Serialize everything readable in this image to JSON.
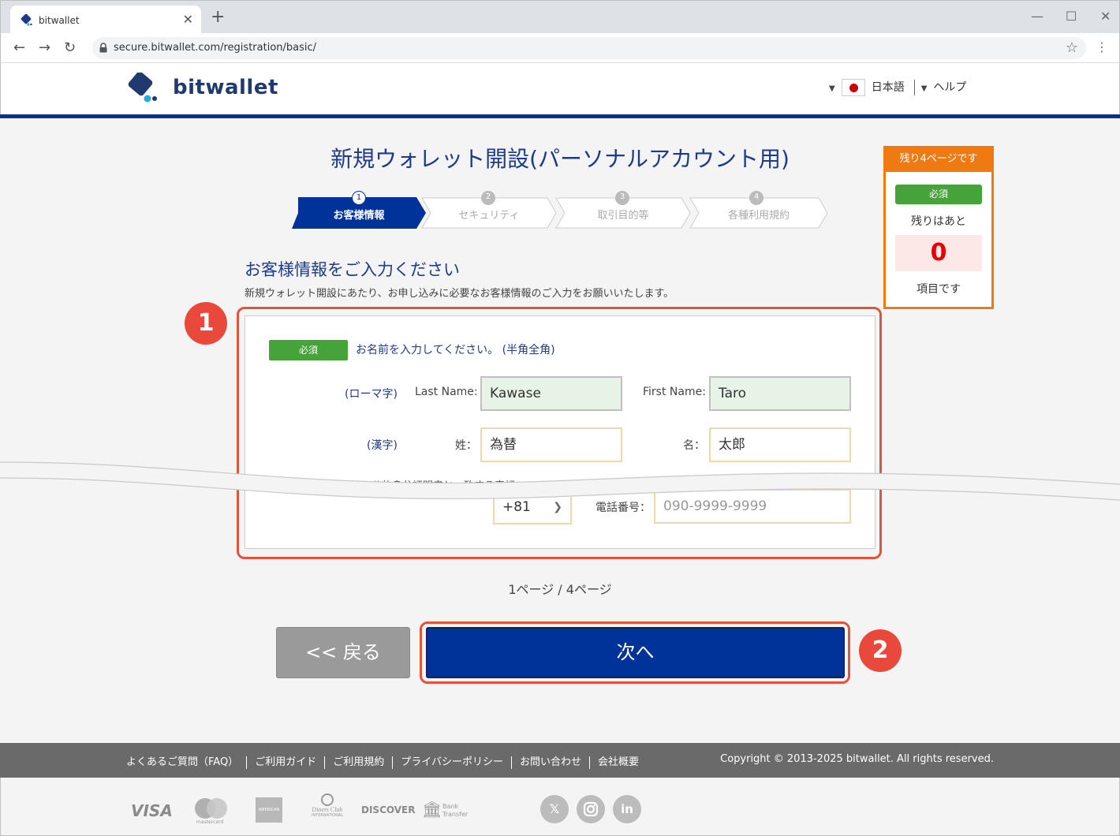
{
  "browser": {
    "tab_title": "bitwallet",
    "url": "secure.bitwallet.com/registration/basic/"
  },
  "header": {
    "brand": "bitwallet",
    "language": "日本語",
    "help": "ヘルプ"
  },
  "main": {
    "page_title": "新規ウォレット開設(パーソナルアカウント用)",
    "steps": [
      {
        "num": "1",
        "label": "お客様情報",
        "active": true
      },
      {
        "num": "2",
        "label": "セキュリティ",
        "active": false
      },
      {
        "num": "3",
        "label": "取引目的等",
        "active": false
      },
      {
        "num": "4",
        "label": "各種利用規約",
        "active": false
      }
    ],
    "section_title": "お客様情報をご入力ください",
    "section_desc": "新規ウォレット開設にあたり、お申し込みに必要なお客様情報のご入力をお願いいたします。",
    "callout_1": "1",
    "callout_2": "2",
    "form": {
      "required_badge": "必須",
      "name_hint": "お名前を入力してください。 (半角全角)",
      "romaji_label": "(ローマ字)",
      "last_name_label": "Last Name:",
      "last_name_value": "Kawase",
      "first_name_label": "First Name:",
      "first_name_value": "Taro",
      "kanji_label": "(漢字)",
      "sei_label": "姓：",
      "sei_value": "為替",
      "mei_label": "名：",
      "mei_value": "太郎",
      "note_partial": "ローマ字、漢字ともに公的身分証明書と一致する表記",
      "country_code": "+81",
      "phone_label": "電話番号：",
      "phone_placeholder": "090-9999-9999"
    },
    "pager": "1ページ / 4ページ",
    "back_button": "<< 戻る",
    "next_button": "次へ"
  },
  "sidebar": {
    "remaining_pages": "残り4ページです",
    "required_badge": "必須",
    "remaining_label": "残りはあと",
    "remaining_count": "0",
    "items_label": "項目です"
  },
  "footer": {
    "links": [
      "よくあるご質問（FAQ）",
      "ご利用ガイド",
      "ご利用規約",
      "プライバシーポリシー",
      "お問い合わせ",
      "会社概要"
    ],
    "copyright": "Copyright © 2013-2025 bitwallet. All rights reserved.",
    "payment_logos": {
      "visa": "VISA",
      "mastercard": "mastercard",
      "amex": "AMERICAN EXPRESS",
      "diners_line1": "Diners Club",
      "diners_line2": "INTERNATIONAL",
      "discover": "DISCOVER",
      "bank_line1": "Bank",
      "bank_line2": "Transfer"
    },
    "social_icons": [
      "x-icon",
      "instagram-icon",
      "linkedin-icon"
    ]
  },
  "colors": {
    "brand_blue": "#003399",
    "accent_orange": "#f07a12",
    "required_green": "#45a33a",
    "callout_red": "#e9493a"
  }
}
